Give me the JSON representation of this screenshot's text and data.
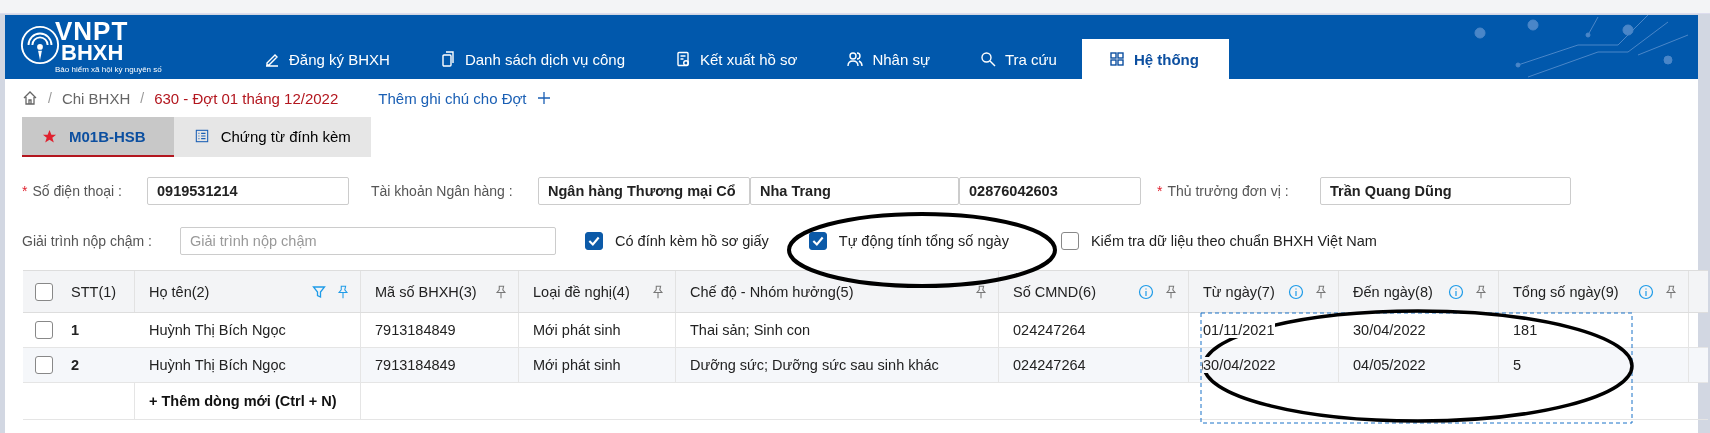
{
  "logo": {
    "line1": "VNPT",
    "line2": "BHXH",
    "tagline": "Bảo hiểm xã hội kỷ nguyên số"
  },
  "nav": [
    {
      "label": "Đăng ký BHXH",
      "selected": false
    },
    {
      "label": "Danh sách dịch vụ công",
      "selected": false
    },
    {
      "label": "Kết xuất hồ sơ",
      "selected": false
    },
    {
      "label": "Nhân sự",
      "selected": false
    },
    {
      "label": "Tra cứu",
      "selected": false
    },
    {
      "label": "Hệ thống",
      "selected": true
    }
  ],
  "breadcrumb": {
    "items": [
      {
        "kind": "separator",
        "text": "/"
      },
      {
        "kind": "link",
        "text": "Chi BHXH"
      },
      {
        "kind": "separator",
        "text": "/"
      }
    ],
    "current": "630 - Đợt 01 tháng 12/2022",
    "note_link": "Thêm ghi chú cho Đợt"
  },
  "tabs": [
    {
      "label": "M01B-HSB",
      "selected": true
    },
    {
      "label": "Chứng từ đính kèm",
      "selected": false
    }
  ],
  "form": {
    "phone": {
      "label": "Số điện thoại :",
      "required_mark": "*",
      "value": "0919531214"
    },
    "bank": {
      "label": "Tài khoản Ngân hàng :",
      "values": [
        "Ngân hàng Thương mại Cổ",
        "Nha Trang",
        "02876042603"
      ]
    },
    "head": {
      "label": "Thủ trưởng đơn vị :",
      "required_mark": "*",
      "value": "Trần Quang Dũng"
    },
    "late": {
      "label": "Giải trình nộp chậm :",
      "placeholder": "Giải trình nộp chậm"
    },
    "checks": [
      {
        "label": "Có đính kèm hồ sơ giấy",
        "checked": true
      },
      {
        "label": "Tự động tính tổng số ngày",
        "checked": true
      },
      {
        "label": "Kiểm tra dữ liệu theo chuẩn BHXH Việt Nam",
        "checked": false
      }
    ]
  },
  "table": {
    "select_all_checked": false,
    "columns": [
      {
        "label": "STT(1)",
        "kind": "select"
      },
      {
        "label": "Họ tên(2)",
        "kind": "filterable"
      },
      {
        "label": "Mã số BHXH(3)",
        "kind": "plain"
      },
      {
        "label": "Loại đề nghị(4)",
        "kind": "plain"
      },
      {
        "label": "Chế độ - Nhóm hưởng(5)",
        "kind": "plain"
      },
      {
        "label": "Số CMND(6)",
        "kind": "info"
      },
      {
        "label": "Từ ngày(7)",
        "kind": "info"
      },
      {
        "label": "Đến ngày(8)",
        "kind": "info"
      },
      {
        "label": "Tổng số ngày(9)",
        "kind": "info"
      }
    ],
    "rows": [
      {
        "checked": false,
        "cells": [
          "1",
          "Huỳnh Thị Bích Ngọc",
          "7913184849",
          "Mới phát sinh",
          "Thai sản; Sinh con",
          "024247264",
          "01/11/2021",
          "30/04/2022",
          "181"
        ]
      },
      {
        "checked": false,
        "cells": [
          "2",
          "Huỳnh Thị Bích Ngọc",
          "7913184849",
          "Mới phát sinh",
          "Dưỡng sức; Dưỡng sức sau sinh khác",
          "024247264",
          "30/04/2022",
          "04/05/2022",
          "5"
        ]
      }
    ],
    "add_row": "+ Thêm dòng mới (Ctrl + N)"
  }
}
